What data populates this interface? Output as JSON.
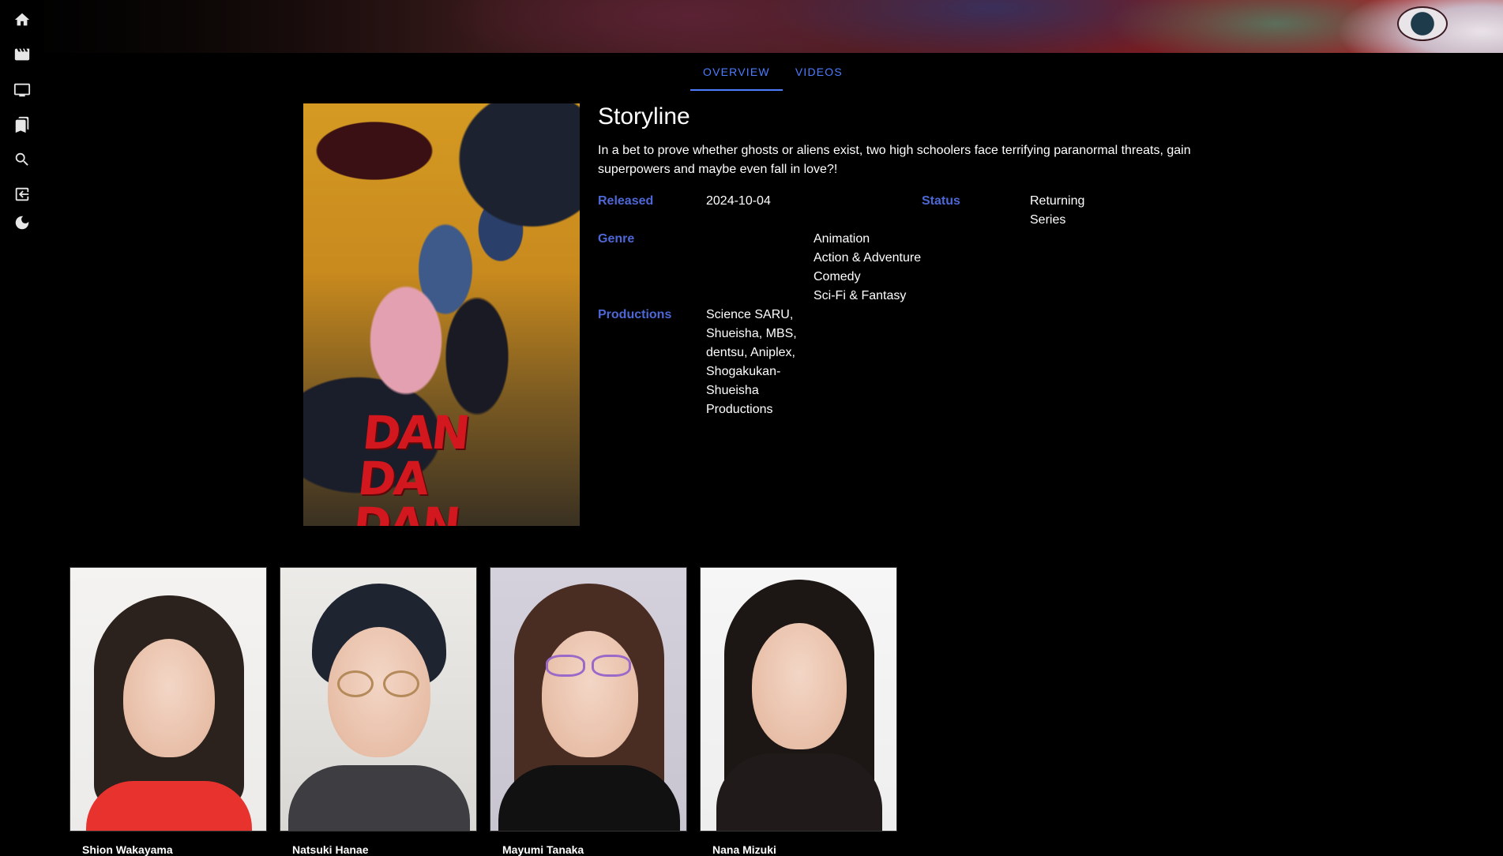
{
  "sidebar": {
    "items": [
      {
        "icon": "home-icon",
        "label": "Home"
      },
      {
        "icon": "movie-icon",
        "label": "Movies"
      },
      {
        "icon": "tv-icon",
        "label": "TV"
      },
      {
        "icon": "bookmarks-icon",
        "label": "Watchlist"
      },
      {
        "icon": "search-icon",
        "label": "Search"
      },
      {
        "icon": "logout-icon",
        "label": "Logout"
      },
      {
        "icon": "moon-icon",
        "label": "Theme"
      }
    ]
  },
  "tabs": [
    {
      "label": "Overview",
      "active": true
    },
    {
      "label": "Videos",
      "active": false
    }
  ],
  "accent_color": "#4d7cff",
  "poster": {
    "logo_text": "DAN DA DAN"
  },
  "overview": {
    "heading": "Storyline",
    "storyline": "In a bet to prove whether ghosts or aliens exist, two high schoolers face terrifying paranormal threats, gain superpowers and maybe even fall in love?!",
    "released_label": "Released",
    "released_value": "2024-10-04",
    "status_label": "Status",
    "status_value": "Returning Series",
    "genre_label": "Genre",
    "genres": [
      "Animation",
      "Action & Adventure",
      "Comedy",
      "Sci-Fi & Fantasy"
    ],
    "productions_label": "Productions",
    "productions": "Science SARU, Shueisha, MBS, dentsu, Aniplex, Shogakukan-Shueisha Productions"
  },
  "cast": [
    {
      "name": "Shion Wakayama"
    },
    {
      "name": "Natsuki Hanae"
    },
    {
      "name": "Mayumi Tanaka"
    },
    {
      "name": "Nana Mizuki"
    }
  ]
}
